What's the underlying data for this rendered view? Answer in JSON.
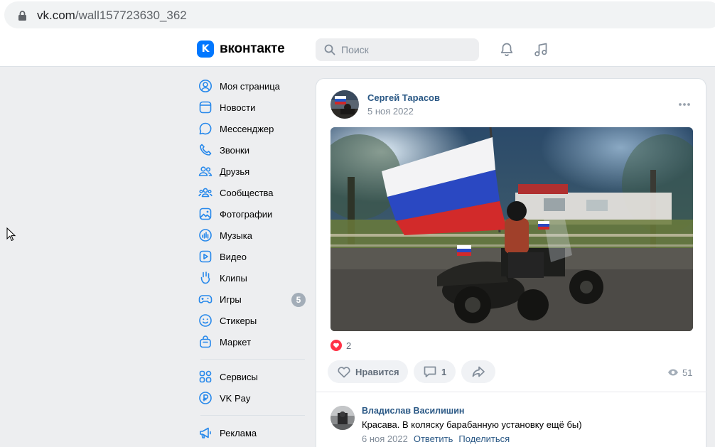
{
  "browser": {
    "url_domain": "vk.com",
    "url_path": "/wall157723630_362"
  },
  "header": {
    "logo_mark": "K",
    "logo_text": "вконтакте",
    "search_placeholder": "Поиск",
    "icons": [
      "bell-icon",
      "music-note-icon"
    ]
  },
  "nav": {
    "items": [
      {
        "label": "Моя страница",
        "icon": "profile-icon"
      },
      {
        "label": "Новости",
        "icon": "news-icon"
      },
      {
        "label": "Мессенджер",
        "icon": "chat-icon"
      },
      {
        "label": "Звонки",
        "icon": "phone-icon"
      },
      {
        "label": "Друзья",
        "icon": "friends-icon"
      },
      {
        "label": "Сообщества",
        "icon": "communities-icon"
      },
      {
        "label": "Фотографии",
        "icon": "photo-icon"
      },
      {
        "label": "Музыка",
        "icon": "music-icon"
      },
      {
        "label": "Видео",
        "icon": "video-icon"
      },
      {
        "label": "Клипы",
        "icon": "clips-icon"
      },
      {
        "label": "Игры",
        "icon": "games-icon",
        "badge": "5"
      },
      {
        "label": "Стикеры",
        "icon": "stickers-icon"
      },
      {
        "label": "Маркет",
        "icon": "market-icon"
      }
    ],
    "group2": [
      {
        "label": "Сервисы",
        "icon": "services-icon"
      },
      {
        "label": "VK Pay",
        "icon": "vkpay-icon"
      }
    ],
    "group3": [
      {
        "label": "Реклама",
        "icon": "megaphone-icon"
      }
    ]
  },
  "post": {
    "author": "Сергей Тарасов",
    "date": "5 ноя 2022",
    "likes_count": "2",
    "like_label": "Нравится",
    "comments_count": "1",
    "views_count": "51"
  },
  "comment": {
    "author": "Владислав Василишин",
    "text": "Красава. В коляску барабанную установку ещё бы)",
    "date": "6 ноя 2022",
    "reply_label": "Ответить",
    "share_label": "Поделиться"
  },
  "colors": {
    "accent": "#0077ff",
    "link": "#2a5885",
    "icon": "#2688eb",
    "like": "#ff3347",
    "page_bg": "#edeef0"
  }
}
